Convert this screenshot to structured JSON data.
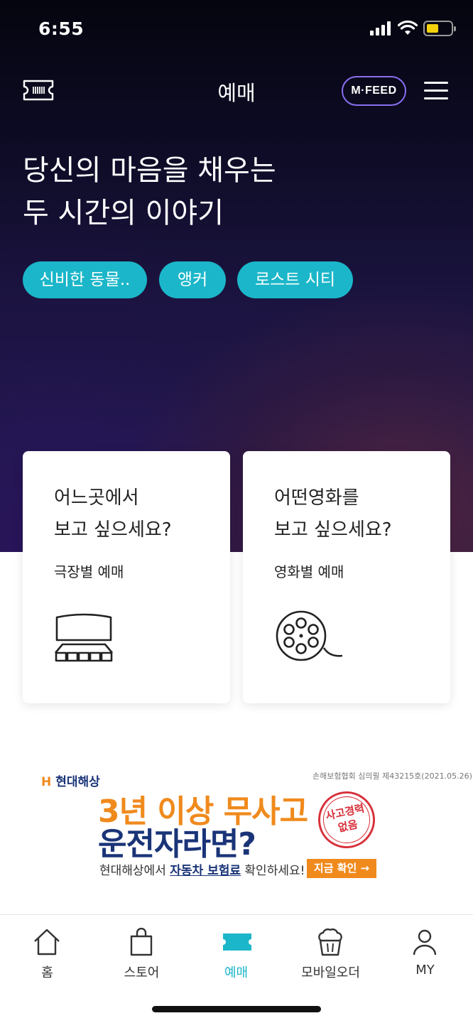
{
  "status_bar": {
    "time": "6:55"
  },
  "header": {
    "title": "예매",
    "mfeed_label": "M·FEED"
  },
  "hero": {
    "headline_line1": "당신의 마음을 채우는",
    "headline_line2": "두 시간의 이야기",
    "chips": [
      "신비한 동물..",
      "앵커",
      "로스트 시티"
    ]
  },
  "cards": [
    {
      "title_line1": "어느곳에서",
      "title_line2": "보고 싶으세요?",
      "subtitle": "극장별 예매",
      "icon": "theater-seats-icon"
    },
    {
      "title_line1": "어떤영화를",
      "title_line2": "보고 싶으세요?",
      "subtitle": "영화별 예매",
      "icon": "film-reel-icon"
    }
  ],
  "ad": {
    "brand": "현대해상",
    "fine_print": "손해보험협회 심의필 제43215호(2021.05.26)",
    "line1": "3년 이상 무사고",
    "line2": "운전자라면?",
    "stamp": "사고경력 없음",
    "line3_prefix": "현대해상에서 ",
    "line3_highlight": "자동차 보험료",
    "line3_suffix": " 확인하세요!",
    "cta": "지금 확인 →"
  },
  "bottom_nav": [
    {
      "label": "홈",
      "icon": "home-icon",
      "active": false
    },
    {
      "label": "스토어",
      "icon": "shopping-bag-icon",
      "active": false
    },
    {
      "label": "예매",
      "icon": "ticket-icon",
      "active": true
    },
    {
      "label": "모바일오더",
      "icon": "popcorn-icon",
      "active": false
    },
    {
      "label": "MY",
      "icon": "user-icon",
      "active": false
    }
  ],
  "colors": {
    "accent": "#1bb6c9",
    "ad_orange": "#f08a1d",
    "ad_navy": "#1a3478"
  }
}
